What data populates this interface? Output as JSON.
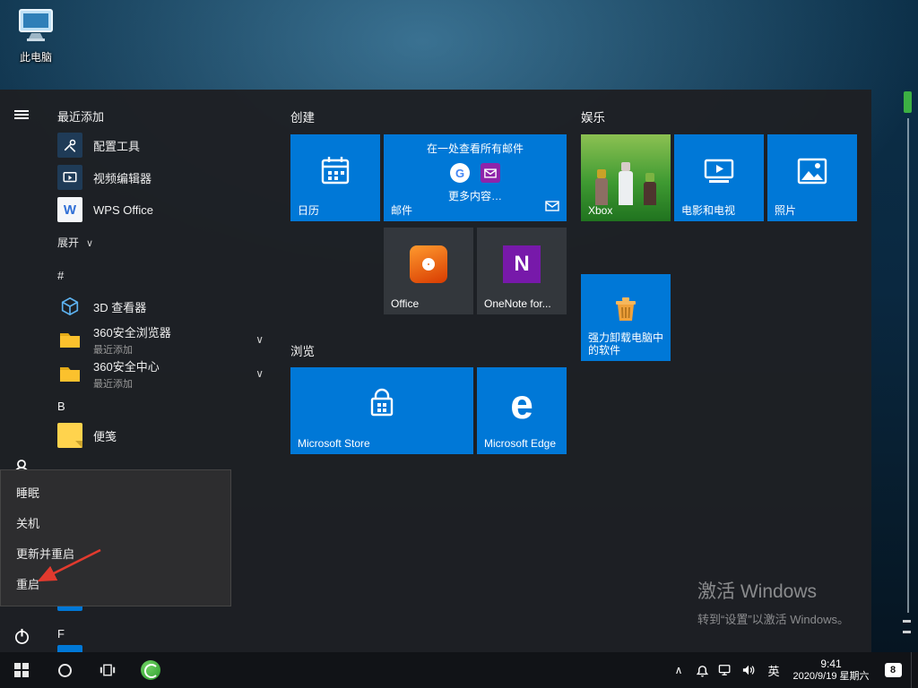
{
  "desktop": {
    "this_pc_label": "此电脑",
    "activate_title": "激活 Windows",
    "activate_subtitle": "转到“设置”以激活 Windows。"
  },
  "start_menu": {
    "recent_header": "最近添加",
    "recent_apps": [
      {
        "label": "配置工具"
      },
      {
        "label": "视频编辑器"
      },
      {
        "label": "WPS Office"
      }
    ],
    "expand_label": "展开",
    "sections": {
      "hash": "#",
      "b": "B",
      "f": "F"
    },
    "apps": {
      "viewer3d": {
        "label": "3D 查看器"
      },
      "browser360": {
        "label": "360安全浏览器",
        "sub": "最近添加"
      },
      "center360": {
        "label": "360安全中心",
        "sub": "最近添加"
      },
      "sticky": {
        "label": "便笺"
      }
    },
    "groups": {
      "create": "创建",
      "browse": "浏览",
      "entertainment": "娱乐"
    },
    "tiles": {
      "calendar": "日历",
      "mail": "邮件",
      "mail_banner": "在一处查看所有邮件",
      "mail_more": "更多内容…",
      "office": "Office",
      "onenote": "OneNote for...",
      "store": "Microsoft Store",
      "edge": "Microsoft Edge",
      "xbox": "Xbox",
      "movies": "电影和电视",
      "photos": "照片",
      "uninstall_l1": "强力卸载电脑中",
      "uninstall_l2": "的软件"
    },
    "power_menu": [
      "睡眠",
      "关机",
      "更新并重启",
      "重启"
    ]
  },
  "taskbar": {
    "lang_indicator": "英",
    "time": "9:41",
    "date": "2020/9/19 星期六",
    "notification_count": "8"
  }
}
